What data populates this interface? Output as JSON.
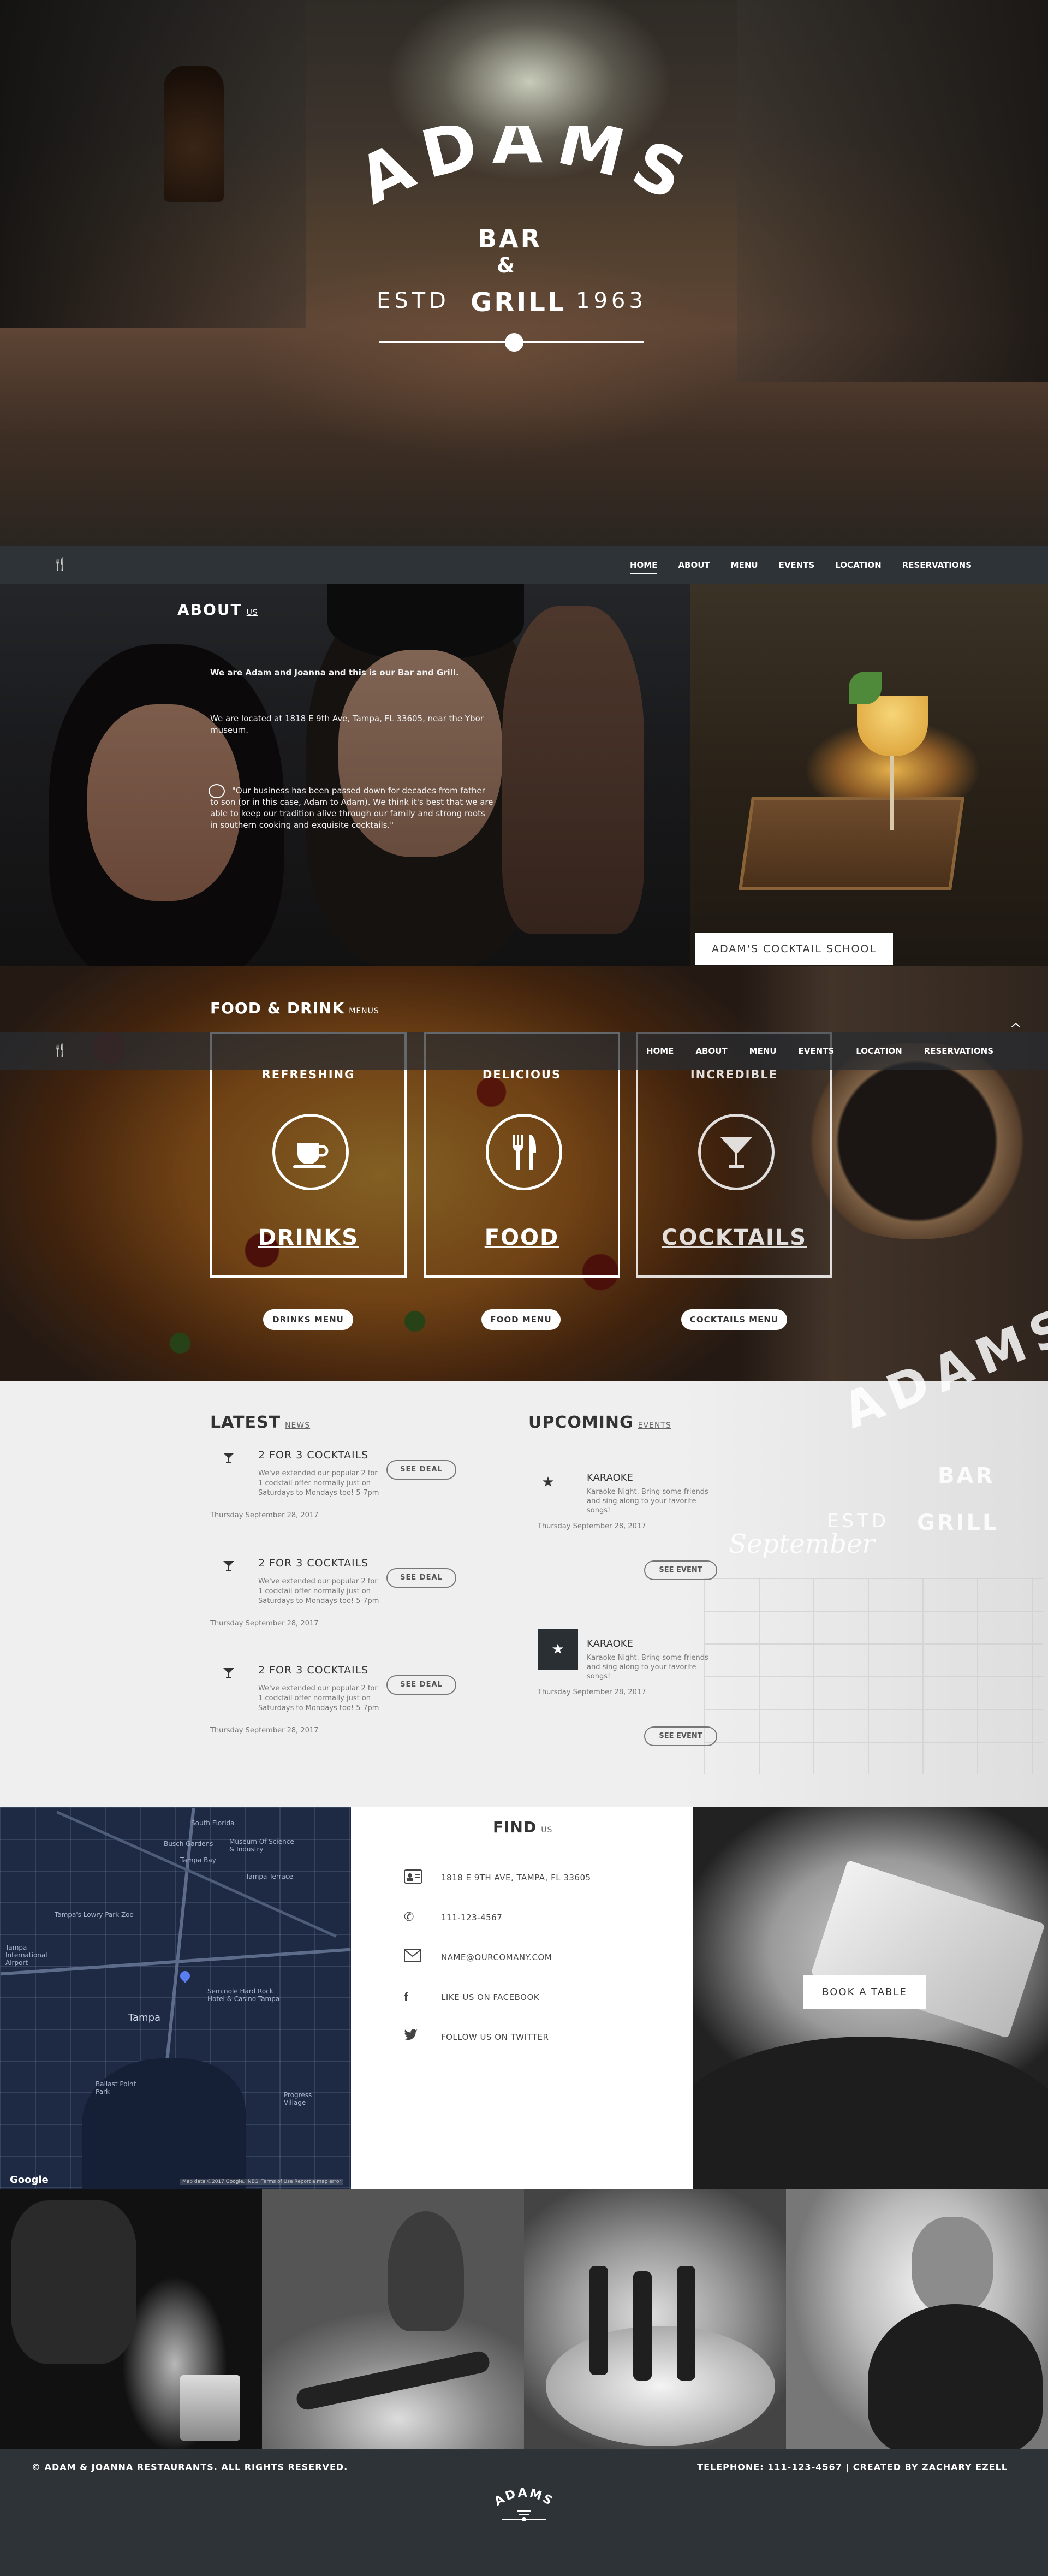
{
  "hero": {
    "logo": {
      "adams": "ADAMS",
      "bar": "BAR",
      "amp": "&",
      "grill": "GRILL",
      "estd": "ESTD",
      "year": "1963"
    }
  },
  "nav": {
    "brand_icon": "fork-knife-icon",
    "items": [
      {
        "label": "HOME",
        "active": true
      },
      {
        "label": "ABOUT"
      },
      {
        "label": "MENU"
      },
      {
        "label": "EVENTS"
      },
      {
        "label": "LOCATION"
      },
      {
        "label": "RESERVATIONS"
      }
    ]
  },
  "about": {
    "title": "ABOUT",
    "subtitle": "US",
    "p1": "We are Adam and Joanna and this is our Bar and Grill.",
    "p2": "We are located at 1818 E 9th Ave, Tampa, FL 33605, near the Ybor museum.",
    "p3": "\"Our business has been passed down for decades from father to son (or in this case, Adam to Adam). We think it's best that we are able to keep our tradition alive through our family and strong roots in southern cooking and exquisite cocktails.\"",
    "quote_icon": "speech-bubble-icon",
    "button": "ADAM'S COCKTAIL SCHOOL"
  },
  "food": {
    "title": "FOOD & DRINK",
    "subtitle": "MENUS",
    "cards": [
      {
        "top": "REFRESHING",
        "big": "DRINKS",
        "icon": "coffee-cup-icon",
        "button": "DRINKS MENU"
      },
      {
        "top": "DELICIOUS",
        "big": "FOOD",
        "icon": "fork-knife-icon",
        "button": "FOOD MENU"
      },
      {
        "top": "INCREDIBLE",
        "big": "COCKTAILS",
        "icon": "martini-glass-icon",
        "button": "COCKTAILS MENU"
      }
    ],
    "scroll_up": "^"
  },
  "news": {
    "title": "LATEST",
    "subtitle": "NEWS",
    "items": [
      {
        "title": "2 FOR 3 COCKTAILS",
        "desc": "We've extended our popular 2 for 1 cocktail offer normally just on Saturdays to Mondays too! 5-7pm",
        "button": "SEE DEAL",
        "date": "Thursday September 28, 2017"
      },
      {
        "title": "2 FOR 3 COCKTAILS",
        "desc": "We've extended our popular 2 for 1 cocktail offer normally just on Saturdays to Mondays too! 5-7pm",
        "button": "SEE DEAL",
        "date": "Thursday September 28, 2017"
      },
      {
        "title": "2 FOR 3 COCKTAILS",
        "desc": "We've extended our popular 2 for 1 cocktail offer normally just on Saturdays to Mondays too! 5-7pm",
        "button": "SEE DEAL",
        "date": "Thursday September 28, 2017"
      }
    ]
  },
  "events": {
    "title": "UPCOMING",
    "subtitle": "EVENTS",
    "items": [
      {
        "title": "KARAOKE",
        "desc": "Karaoke Night. Bring some friends and sing along to your favorite songs!",
        "date": "Thursday September 28, 2017",
        "button": "SEE EVENT"
      },
      {
        "title": "KARAOKE",
        "desc": "Karaoke Night. Bring some friends and sing along to your favorite songs!",
        "date": "Thursday September 28, 2017",
        "button": "SEE EVENT"
      }
    ],
    "ghost": {
      "adams": "ADAMS",
      "bar": "BAR",
      "grill": "GRILL",
      "estd": "ESTD",
      "month": "September"
    }
  },
  "map": {
    "labels": [
      "South Florida",
      "Busch Gardens",
      "Museum Of Science & Industry",
      "Tampa Terrace",
      "Tampa Bay",
      "Tampa's Lowry Park Zoo",
      "Seminole Hard Rock Hotel & Casino Tampa",
      "Tampa",
      "Ballast Point Park",
      "Progress Village",
      "Tampa International Airport"
    ],
    "attribution": "Google",
    "terms": "Map data ©2017 Google, INEGI  Terms of Use  Report a map error"
  },
  "find": {
    "title": "FIND",
    "subtitle": "US",
    "rows": [
      {
        "icon": "address-card-icon",
        "text": "1818 E 9TH AVE, TAMPA, FL 33605"
      },
      {
        "icon": "phone-icon",
        "text": "111-123-4567"
      },
      {
        "icon": "envelope-icon",
        "text": "NAME@OURCOMANY.COM"
      },
      {
        "icon": "facebook-icon",
        "text": "LIKE US ON FACEBOOK"
      },
      {
        "icon": "twitter-icon",
        "text": "FOLLOW US ON TWITTER"
      }
    ],
    "button": "BOOK A TABLE"
  },
  "footer": {
    "copyright": "© ADAM & JOANNA RESTAURANTS. ALL RIGHTS RESERVED.",
    "right": "TELEPHONE: 111-123-4567 | CREATED BY ZACHARY EZELL",
    "logo_text": "ADAMS"
  },
  "colors": {
    "nav": "#2e3338",
    "news_bg": "#efefef",
    "white": "#ffffff"
  }
}
